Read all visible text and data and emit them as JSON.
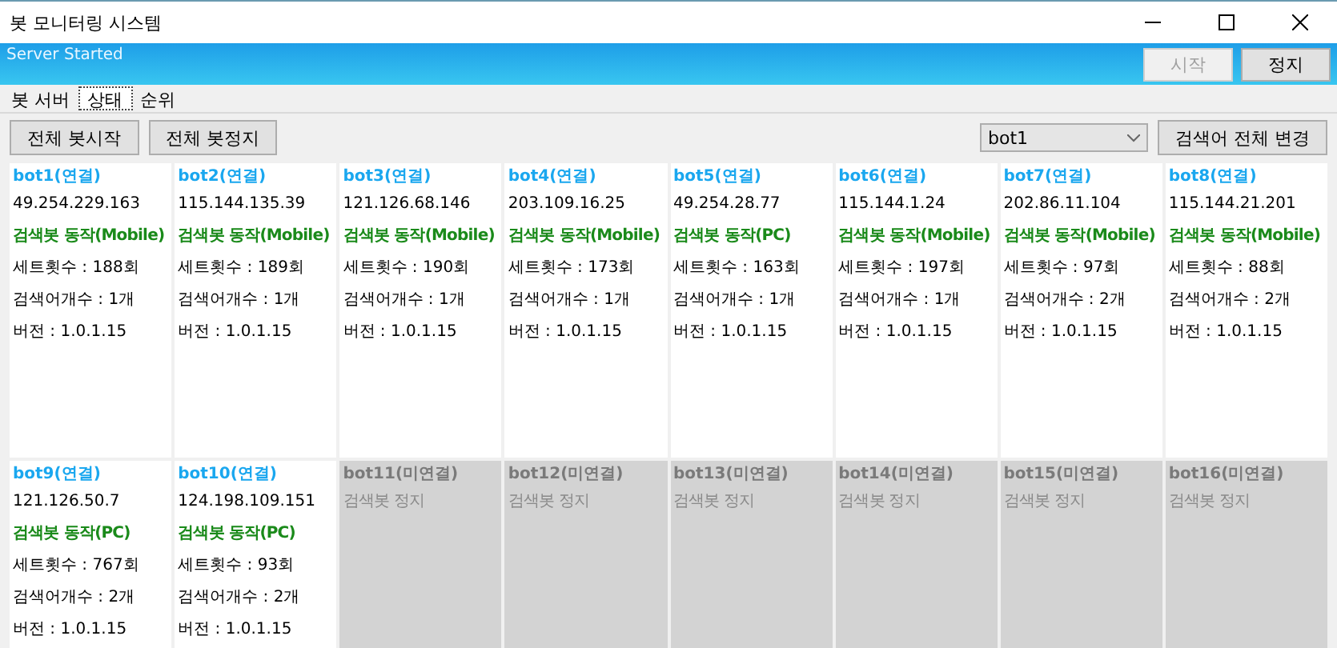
{
  "window": {
    "title": "봇 모니터링 시스템"
  },
  "banner": {
    "status": "Server Started",
    "buttons": [
      {
        "label": "시작",
        "disabled": true
      },
      {
        "label": "정지",
        "disabled": false
      }
    ]
  },
  "tabs": [
    {
      "label": "봇 서버",
      "selected": false
    },
    {
      "label": "상태",
      "selected": true
    },
    {
      "label": "순위",
      "selected": false
    }
  ],
  "toolbar": {
    "buttons": [
      "전체 봇시작",
      "전체 봇정지"
    ],
    "bot_select": {
      "value": "bot1"
    },
    "apply_button": "검색어 전체 변경"
  },
  "bots": [
    {
      "name": "bot1(연결)",
      "connected": true,
      "ip": "49.254.229.163",
      "status": "검색봇 동작(Mobile)",
      "sets": "세트횟수 : 188회",
      "keywords": "검색어개수 : 1개",
      "version": "버전 : 1.0.1.15"
    },
    {
      "name": "bot2(연결)",
      "connected": true,
      "ip": "115.144.135.39",
      "status": "검색봇 동작(Mobile)",
      "sets": "세트횟수 : 189회",
      "keywords": "검색어개수 : 1개",
      "version": "버전 : 1.0.1.15"
    },
    {
      "name": "bot3(연결)",
      "connected": true,
      "ip": "121.126.68.146",
      "status": "검색봇 동작(Mobile)",
      "sets": "세트횟수 : 190회",
      "keywords": "검색어개수 : 1개",
      "version": "버전 : 1.0.1.15"
    },
    {
      "name": "bot4(연결)",
      "connected": true,
      "ip": "203.109.16.25",
      "status": "검색봇 동작(Mobile)",
      "sets": "세트횟수 : 173회",
      "keywords": "검색어개수 : 1개",
      "version": "버전 : 1.0.1.15"
    },
    {
      "name": "bot5(연결)",
      "connected": true,
      "ip": "49.254.28.77",
      "status": "검색봇 동작(PC)",
      "sets": "세트횟수 : 163회",
      "keywords": "검색어개수 : 1개",
      "version": "버전 : 1.0.1.15"
    },
    {
      "name": "bot6(연결)",
      "connected": true,
      "ip": "115.144.1.24",
      "status": "검색봇 동작(Mobile)",
      "sets": "세트횟수 : 197회",
      "keywords": "검색어개수 : 1개",
      "version": "버전 : 1.0.1.15"
    },
    {
      "name": "bot7(연결)",
      "connected": true,
      "ip": "202.86.11.104",
      "status": "검색봇 동작(Mobile)",
      "sets": "세트횟수 : 97회",
      "keywords": "검색어개수 : 2개",
      "version": "버전 : 1.0.1.15"
    },
    {
      "name": "bot8(연결)",
      "connected": true,
      "ip": "115.144.21.201",
      "status": "검색봇 동작(Mobile)",
      "sets": "세트횟수 : 88회",
      "keywords": "검색어개수 : 2개",
      "version": "버전 : 1.0.1.15"
    },
    {
      "name": "bot9(연결)",
      "connected": true,
      "ip": "121.126.50.7",
      "status": "검색봇 동작(PC)",
      "sets": "세트횟수 : 767회",
      "keywords": "검색어개수 : 2개",
      "version": "버전 : 1.0.1.15"
    },
    {
      "name": "bot10(연결)",
      "connected": true,
      "ip": "124.198.109.151",
      "status": "검색봇 동작(PC)",
      "sets": "세트횟수 : 93회",
      "keywords": "검색어개수 : 2개",
      "version": "버전 : 1.0.1.15"
    },
    {
      "name": "bot11(미연결)",
      "connected": false,
      "status": "검색봇 정지"
    },
    {
      "name": "bot12(미연결)",
      "connected": false,
      "status": "검색봇 정지"
    },
    {
      "name": "bot13(미연결)",
      "connected": false,
      "status": "검색봇 정지"
    },
    {
      "name": "bot14(미연결)",
      "connected": false,
      "status": "검색봇 정지"
    },
    {
      "name": "bot15(미연결)",
      "connected": false,
      "status": "검색봇 정지"
    },
    {
      "name": "bot16(미연결)",
      "connected": false,
      "status": "검색봇 정지"
    }
  ]
}
